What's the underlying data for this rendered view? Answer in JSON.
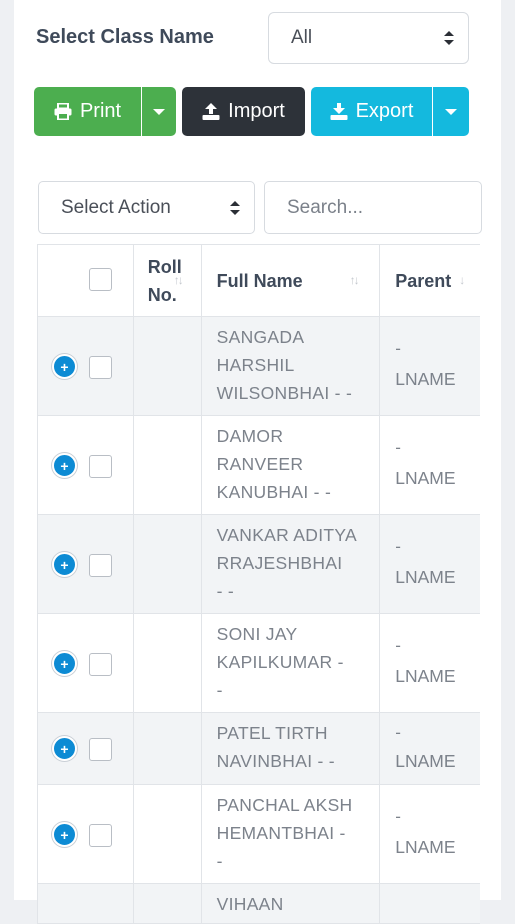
{
  "filter": {
    "class_label": "Select Class Name",
    "class_value": "All"
  },
  "toolbar": {
    "print_label": "Print",
    "import_label": "Import",
    "export_label": "Export"
  },
  "actions": {
    "select_action": "Select Action",
    "search_placeholder": "Search..."
  },
  "table": {
    "headers": {
      "roll": "Roll\nNo.",
      "full_name": "Full Name",
      "parent": "Parent"
    },
    "rows": [
      {
        "roll": "",
        "name": "SANGADA\nHARSHIL\nWILSONBHAI - -",
        "parent_top": "-",
        "parent_lname": "LNAME"
      },
      {
        "roll": "",
        "name": "DAMOR\nRANVEER\nKANUBHAI - -",
        "parent_top": "-",
        "parent_lname": "LNAME"
      },
      {
        "roll": "",
        "name": "VANKAR ADITYA\nRRAJESHBHAI\n- -",
        "parent_top": "-",
        "parent_lname": "LNAME"
      },
      {
        "roll": "",
        "name": "SONI JAY\nKAPILKUMAR -\n-",
        "parent_top": "-",
        "parent_lname": "LNAME"
      },
      {
        "roll": "",
        "name": "PATEL TIRTH\nNAVINBHAI - -",
        "parent_top": "-",
        "parent_lname": "LNAME"
      },
      {
        "roll": "",
        "name": "PANCHAL AKSH\nHEMANTBHAI -\n-",
        "parent_top": "-",
        "parent_lname": "LNAME"
      }
    ],
    "partial_row_name": "VIHAAN"
  },
  "colors": {
    "print": "#4cae4f",
    "import": "#2d3239",
    "export": "#14b9de",
    "expand": "#0d8bd4"
  }
}
